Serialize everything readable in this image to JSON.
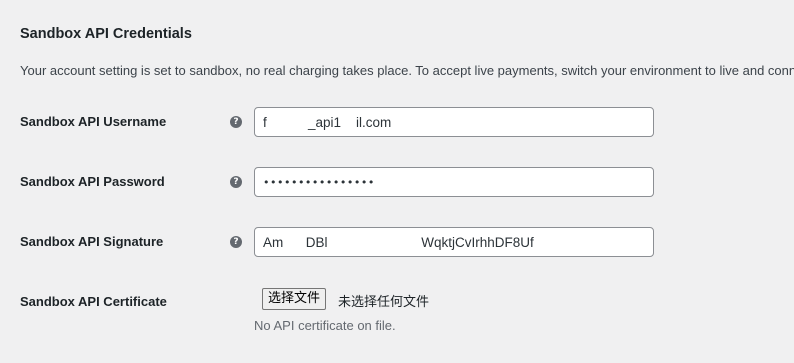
{
  "section": {
    "title": "Sandbox API Credentials",
    "description": "Your account setting is set to sandbox, no real charging takes place. To accept live payments, switch your environment to live and conne"
  },
  "fields": {
    "username": {
      "label": "Sandbox API Username",
      "value": "f           _api1    il.com"
    },
    "password": {
      "label": "Sandbox API Password",
      "value": "••••••••••••••••"
    },
    "signature": {
      "label": "Sandbox API Signature",
      "value": "Am      DBl                         WqktjCvIrhhDF8Uf"
    },
    "certificate": {
      "label": "Sandbox API Certificate",
      "button_label": "选择文件",
      "status": "未选择任何文件",
      "note": "No API certificate on file."
    }
  },
  "help_icon_glyph": "?"
}
